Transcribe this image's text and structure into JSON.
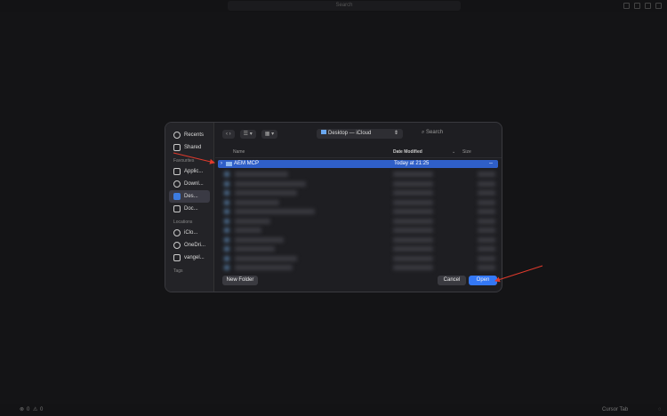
{
  "topbar": {
    "search": "Search"
  },
  "sidebar": {
    "items_top": [
      {
        "label": "Recents",
        "icon": "clock-icon"
      },
      {
        "label": "Shared",
        "icon": "shared-folder-icon"
      }
    ],
    "favourites_heading": "Favourites",
    "favourites": [
      {
        "label": "Applic...",
        "icon": "applications-icon"
      },
      {
        "label": "Downl...",
        "icon": "download-icon"
      },
      {
        "label": "Des...",
        "icon": "desktop-icon"
      },
      {
        "label": "Doc...",
        "icon": "document-icon"
      }
    ],
    "locations_heading": "Locations",
    "locations": [
      {
        "label": "iClo...",
        "icon": "cloud-icon"
      },
      {
        "label": "OneDri...",
        "icon": "onedrive-icon"
      },
      {
        "label": "vangel...",
        "icon": "home-icon"
      }
    ],
    "tags_heading": "Tags"
  },
  "toolbar": {
    "location": "Desktop — iCloud",
    "search_placeholder": "Search"
  },
  "columns": {
    "name": "Name",
    "date": "Date Modified",
    "size": "Size"
  },
  "selected_row": {
    "name": "AEM MCP",
    "date": "Today at 21:25",
    "size": "--"
  },
  "footer": {
    "new_folder": "New Folder",
    "cancel": "Cancel",
    "open": "Open"
  },
  "statusbar": {
    "errors": "0",
    "warnings": "0",
    "cursor_tab": "Cursor Tab"
  },
  "colors": {
    "accent": "#2f5fc8",
    "open_button": "#3478f6",
    "annotation": "#e03a2c"
  }
}
